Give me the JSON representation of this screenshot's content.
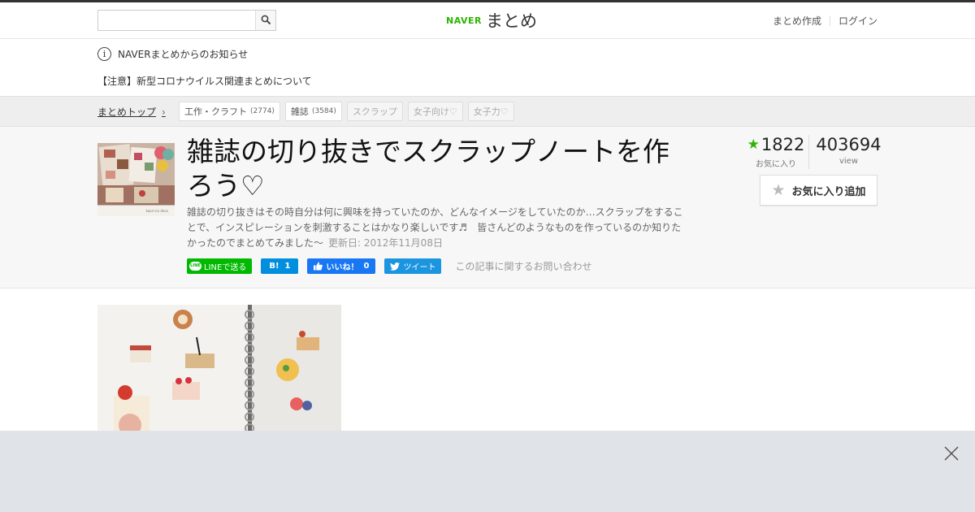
{
  "header": {
    "search_placeholder": "",
    "logo_naver": "NAVER",
    "logo_name": "まとめ",
    "create_label": "まとめ作成",
    "login_label": "ログイン"
  },
  "notice": {
    "title": "NAVERまとめからのお知らせ",
    "info_glyph": "i",
    "link": "【注意】新型コロナウイルス関連まとめについて"
  },
  "breadcrumb": {
    "home": "まとめトップ",
    "chevron": "›",
    "tags": [
      {
        "label": "工作・クラフト",
        "count": "(2774)"
      },
      {
        "label": "雑誌",
        "count": "(3584)"
      },
      {
        "label": "スクラップ",
        "count": ""
      },
      {
        "label": "女子向け♡",
        "count": ""
      },
      {
        "label": "女子力♡",
        "count": ""
      }
    ]
  },
  "article": {
    "title": "雑誌の切り抜きでスクラップノートを作ろう♡",
    "description": "雑誌の切り抜きはその時自分は何に興味を持っていたのか、どんなイメージをしていたのか…スクラップをすることで、インスピレーションを刺激することはかなり楽しいです♬　皆さんどのようなものを作っているのか知りたかったのでまとめてみました～",
    "updated": "更新日: 2012年11月08日",
    "thumb_caption": "kaori-iro deco"
  },
  "share": {
    "line_icon": "LINE",
    "line_label": "LINEで送る",
    "hatena_label": "B!",
    "hatena_count": "1",
    "fb_label": "いいね！",
    "fb_count": "0",
    "tweet_label": "ツイート",
    "contact": "この記事に関するお問い合わせ"
  },
  "stats": {
    "favorites": "1822",
    "favorites_label": "お気に入り",
    "views": "403694",
    "views_label": "view",
    "fav_button": "お気に入り追加",
    "star_glyph": "★"
  },
  "colors": {
    "brand_green": "#2db400",
    "line_green": "#00b900",
    "hatena_blue": "#008fde",
    "facebook_blue": "#1877f2",
    "twitter_blue": "#1b95e0",
    "ad_bar": "#e0e4e8"
  },
  "icons": {
    "search": "search-icon",
    "info": "info-icon",
    "star": "star-icon",
    "close": "close-icon"
  }
}
